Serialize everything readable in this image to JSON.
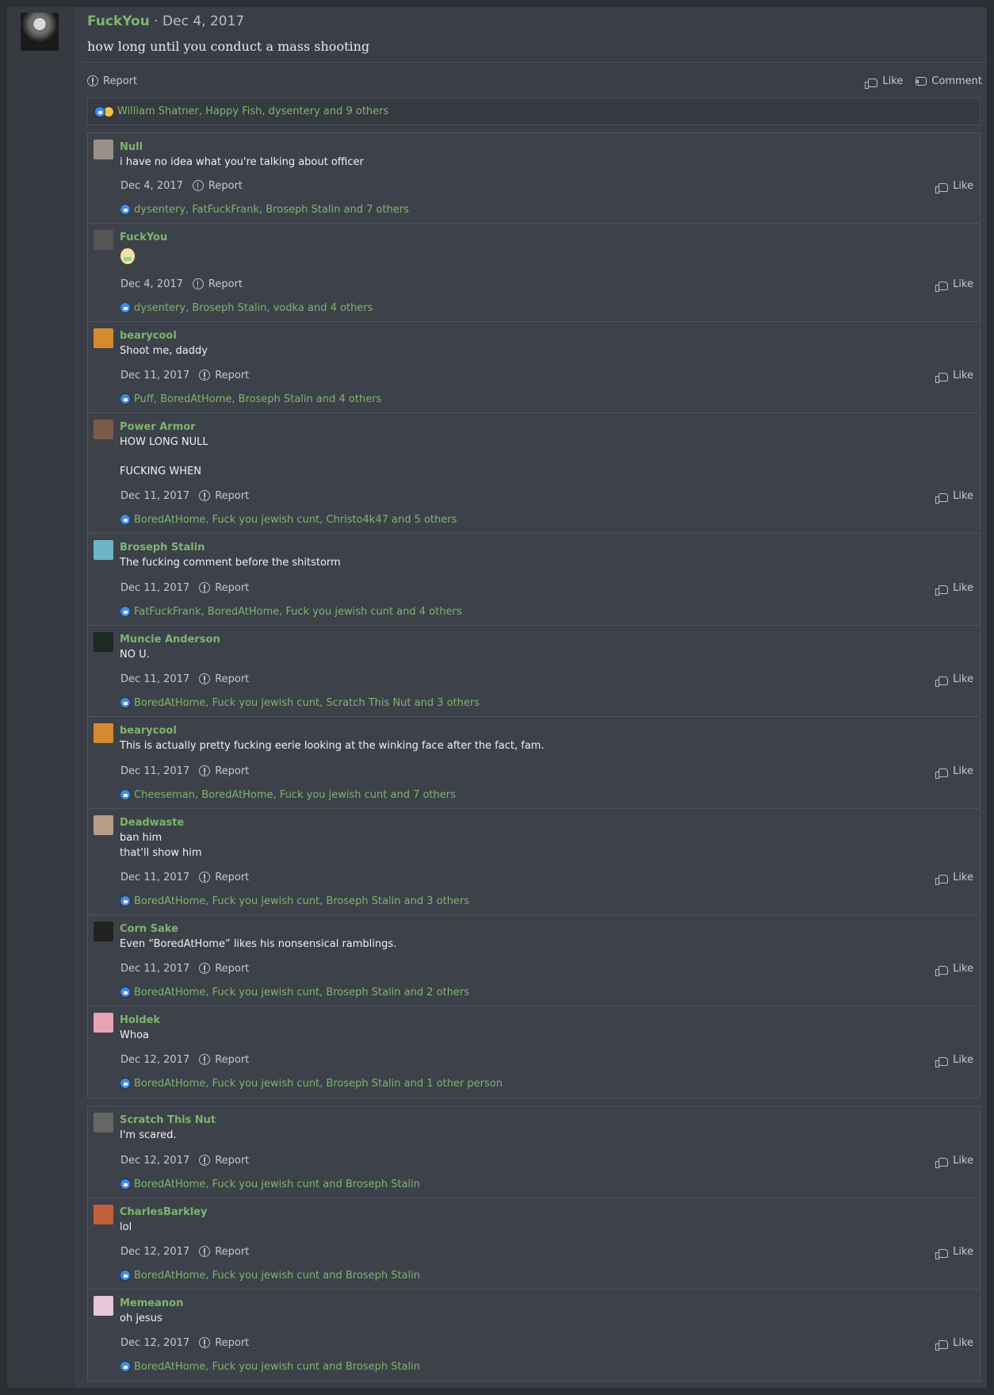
{
  "post": {
    "author": "FuckYou",
    "separator": "·",
    "date": "Dec 4, 2017",
    "text": "how long until you conduct a mass shooting",
    "actions": {
      "report": "Report",
      "like": "Like",
      "comment": "Comment"
    },
    "reactions": "William Shatner, Happy Fish, dysentery and 9 others"
  },
  "comments": [
    {
      "user": "Null",
      "lines": [
        "i have no idea what you're talking about officer"
      ],
      "date": "Dec 4, 2017",
      "report": "Report",
      "like": "Like",
      "reactions": "dysentery, FatFuckFrank, Broseph Stalin and 7 others"
    },
    {
      "user": "FuckYou",
      "lines": [],
      "emoji": "smiling-face-emoji",
      "date": "Dec 4, 2017",
      "report": "Report",
      "like": "Like",
      "reactions": "dysentery, Broseph Stalin, vodka and 4 others"
    },
    {
      "user": "bearycool",
      "lines": [
        "Shoot me, daddy"
      ],
      "date": "Dec 11, 2017",
      "report": "Report",
      "like": "Like",
      "reactions": "Puff, BoredAtHome, Broseph Stalin and 4 others"
    },
    {
      "user": "Power Armor",
      "lines": [
        "HOW LONG NULL",
        "",
        "FUCKING WHEN"
      ],
      "date": "Dec 11, 2017",
      "report": "Report",
      "like": "Like",
      "reactions": "BoredAtHome, Fuck you jewish cunt, Christo4k47 and 5 others"
    },
    {
      "user": "Broseph Stalin",
      "lines": [
        "The fucking comment before the shitstorm"
      ],
      "date": "Dec 11, 2017",
      "report": "Report",
      "like": "Like",
      "reactions": "FatFuckFrank, BoredAtHome, Fuck you jewish cunt and 4 others"
    },
    {
      "user": "Muncie Anderson",
      "lines": [
        "NO U."
      ],
      "date": "Dec 11, 2017",
      "report": "Report",
      "like": "Like",
      "reactions": "BoredAtHome, Fuck you jewish cunt, Scratch This Nut and 3 others"
    },
    {
      "user": "bearycool",
      "lines": [
        "This is actually pretty fucking eerie looking at the winking face after the fact, fam."
      ],
      "date": "Dec 11, 2017",
      "report": "Report",
      "like": "Like",
      "reactions": "Cheeseman, BoredAtHome, Fuck you jewish cunt and 7 others"
    },
    {
      "user": "Deadwaste",
      "lines": [
        "ban him",
        "that'll show him"
      ],
      "date": "Dec 11, 2017",
      "report": "Report",
      "like": "Like",
      "reactions": "BoredAtHome, Fuck you jewish cunt, Broseph Stalin and 3 others"
    },
    {
      "user": "Corn Sake",
      "lines": [
        "Even “BoredAtHome” likes his nonsensical ramblings."
      ],
      "date": "Dec 11, 2017",
      "report": "Report",
      "like": "Like",
      "reactions": "BoredAtHome, Fuck you jewish cunt, Broseph Stalin and 2 others"
    },
    {
      "user": "Holdek",
      "lines": [
        "Whoa"
      ],
      "date": "Dec 12, 2017",
      "report": "Report",
      "like": "Like",
      "reactions": "BoredAtHome, Fuck you jewish cunt, Broseph Stalin and 1 other person"
    },
    {
      "user": "Scratch This Nut",
      "lines": [
        "I'm scared."
      ],
      "date": "Dec 12, 2017",
      "report": "Report",
      "like": "Like",
      "reactions": "BoredAtHome, Fuck you jewish cunt and Broseph Stalin"
    },
    {
      "user": "CharlesBarkley",
      "lines": [
        "lol"
      ],
      "date": "Dec 12, 2017",
      "report": "Report",
      "like": "Like",
      "reactions": "BoredAtHome, Fuck you jewish cunt and Broseph Stalin"
    },
    {
      "user": "Memeanon",
      "lines": [
        "oh jesus"
      ],
      "date": "Dec 12, 2017",
      "report": "Report",
      "like": "Like",
      "reactions": "BoredAtHome, Fuck you jewish cunt and Broseph Stalin"
    }
  ],
  "colors": {
    "accent": "#7cb66c",
    "like_blue": "#3d8bf2"
  }
}
